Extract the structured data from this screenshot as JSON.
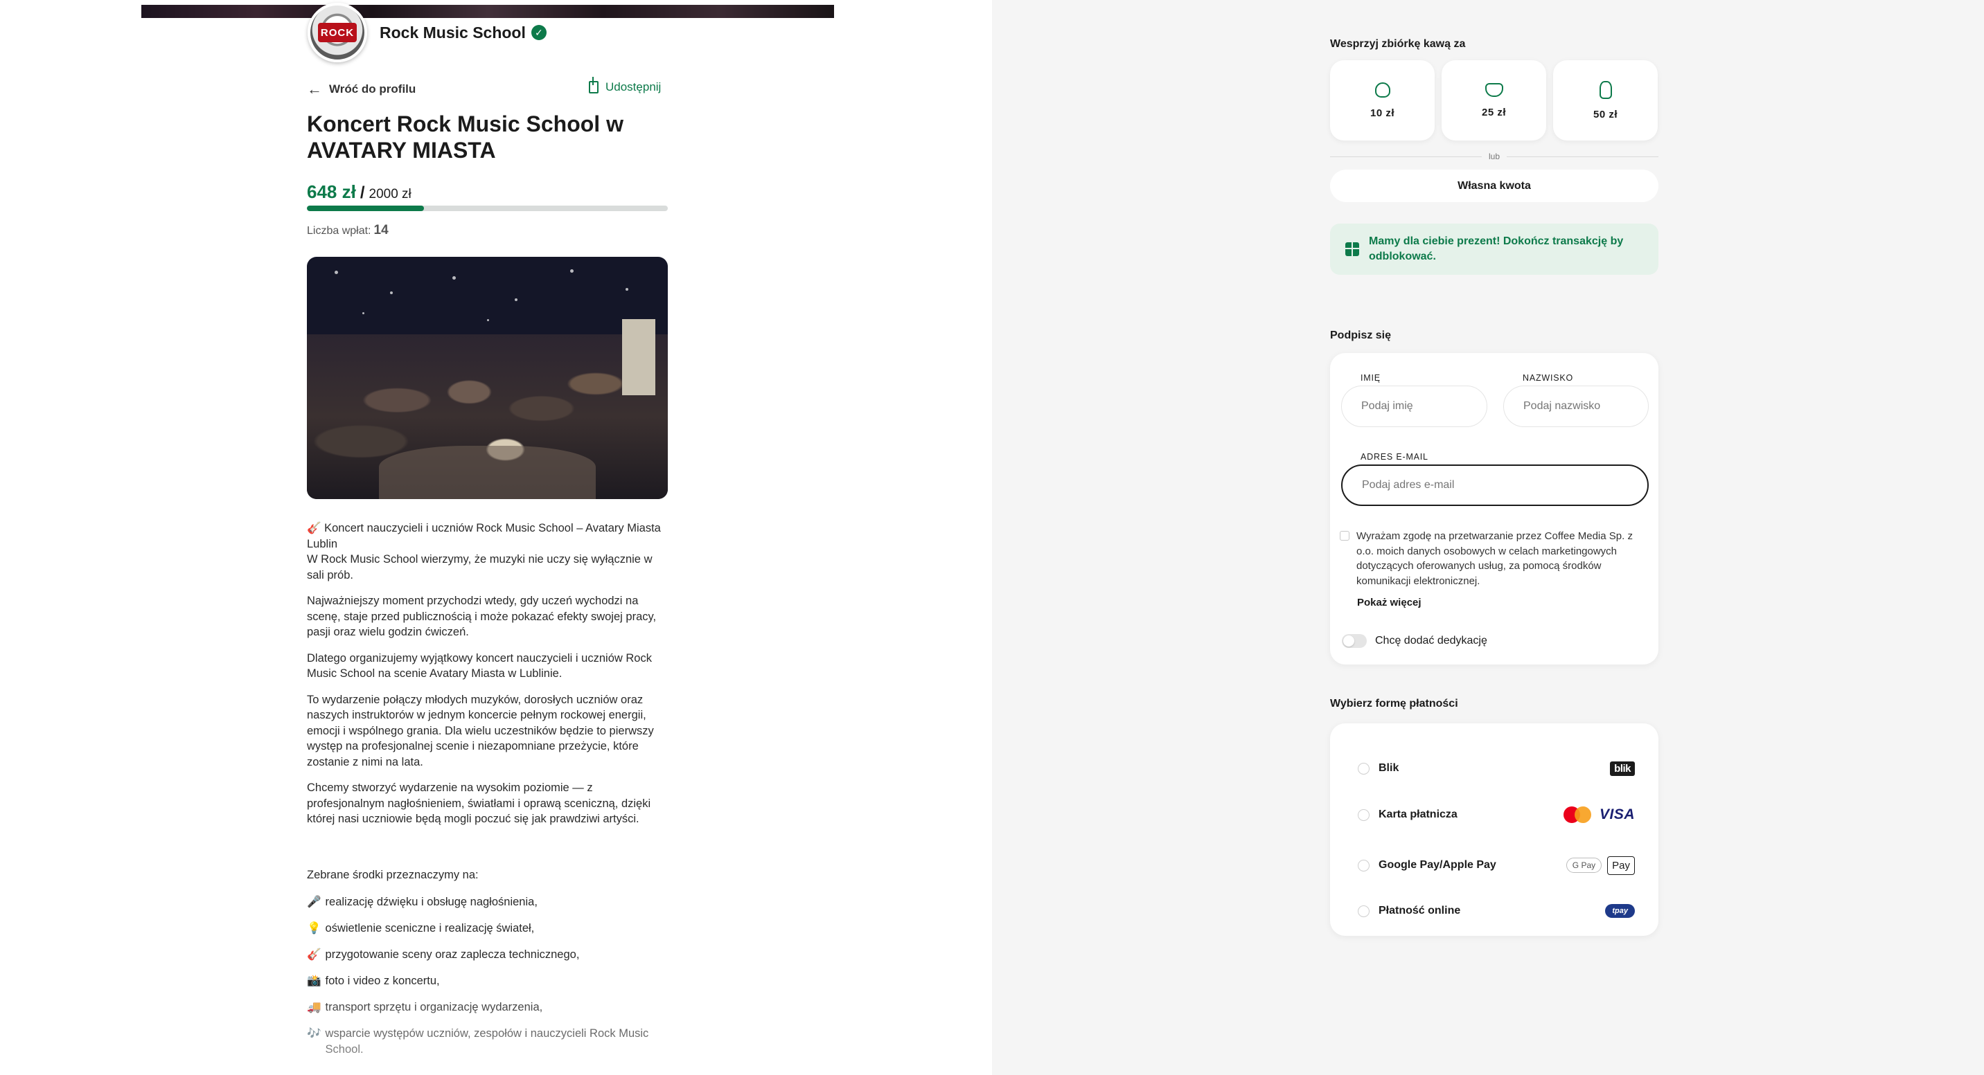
{
  "profile": {
    "name": "Rock Music School",
    "avatar_text": "ROCK"
  },
  "nav": {
    "back_label": "Wróć do profilu",
    "share_label": "Udostępnij"
  },
  "campaign": {
    "title": "Koncert Rock Music School w AVATARY MIASTA",
    "raised": "648 zł",
    "separator": "/",
    "goal": "2000 zł",
    "progress_fraction": 0.324,
    "donations_label": "Liczba wpłat:",
    "donations_count": "14"
  },
  "description": {
    "paragraphs": [
      "🎸 Koncert nauczycieli i uczniów Rock Music School – Avatary Miasta Lublin\nW Rock Music School wierzymy, że muzyki nie uczy się wyłącznie w sali prób.",
      "Najważniejszy moment przychodzi wtedy, gdy uczeń wychodzi na scenę, staje przed publicznością i może pokazać efekty swojej pracy, pasji oraz wielu godzin ćwiczeń.",
      "Dlatego organizujemy wyjątkowy koncert nauczycieli i uczniów Rock Music School na scenie Avatary Miasta w Lublinie.",
      "To wydarzenie połączy młodych muzyków, dorosłych uczniów oraz naszych instruktorów w jednym koncercie pełnym rockowej energii, emocji i wspólnego grania. Dla wielu uczestników będzie to pierwszy występ na profesjonalnej scenie i niezapomniane przeżycie, które zostanie z nimi na lata.",
      "Chcemy stworzyć wydarzenie na wysokim poziomie — z profesjonalnym nagłośnieniem, światłami i oprawą sceniczną, dzięki której nasi uczniowie będą mogli poczuć się jak prawdziwi artyści."
    ],
    "list_intro": "Zebrane środki przeznaczymy na:",
    "list": [
      {
        "icon": "🎤",
        "text": "realizację dźwięku i obsługę nagłośnienia,"
      },
      {
        "icon": "💡",
        "text": "oświetlenie sceniczne i realizację świateł,"
      },
      {
        "icon": "🎸",
        "text": "przygotowanie sceny oraz zaplecza technicznego,"
      },
      {
        "icon": "📸",
        "text": "foto i video z koncertu,"
      },
      {
        "icon": "🚚",
        "text": "transport sprzętu i organizację wydarzenia,"
      },
      {
        "icon": "🎶",
        "text": "wsparcie występów uczniów, zespołów i nauczycieli Rock Music School."
      }
    ]
  },
  "support": {
    "label": "Wesprzyj zbiórkę kawą za",
    "options": [
      {
        "price": "10 zł",
        "icon": "coffee-cup-small-icon"
      },
      {
        "price": "25 zł",
        "icon": "coffee-cup-medium-icon"
      },
      {
        "price": "50 zł",
        "icon": "coffee-cup-large-icon"
      }
    ],
    "or_label": "lub",
    "custom_label": "Własna kwota",
    "gift_text": "Mamy dla ciebie prezent! Dokończ transakcję by odblokować."
  },
  "signup": {
    "label": "Podpisz się",
    "first_name_label": "IMIĘ",
    "first_name_placeholder": "Podaj imię",
    "last_name_label": "NAZWISKO",
    "last_name_placeholder": "Podaj nazwisko",
    "email_label": "ADRES E-MAIL",
    "email_placeholder": "Podaj adres e-mail",
    "consent_text": "Wyrażam zgodę na przetwarzanie przez Coffee Media Sp. z o.o. moich danych osobowych w celach marketingowych dotyczących oferowanych usług, za pomocą środków komunikacji elektronicznej.",
    "show_more": "Pokaż więcej",
    "dedication_label": "Chcę dodać dedykację"
  },
  "payment": {
    "label": "Wybierz formę płatności",
    "methods": [
      {
        "label": "Blik",
        "logo": "blik"
      },
      {
        "label": "Karta płatnicza",
        "logo": "VISA"
      },
      {
        "label": "Google Pay/Apple Pay",
        "logo_a": "G Pay",
        "logo_b": "Pay"
      },
      {
        "label": "Płatność online",
        "logo": "tpay"
      }
    ]
  },
  "colors": {
    "accent": "#0d7a4a",
    "right_bg": "#f5f5f5",
    "gift_bg": "#e5f2ea"
  }
}
